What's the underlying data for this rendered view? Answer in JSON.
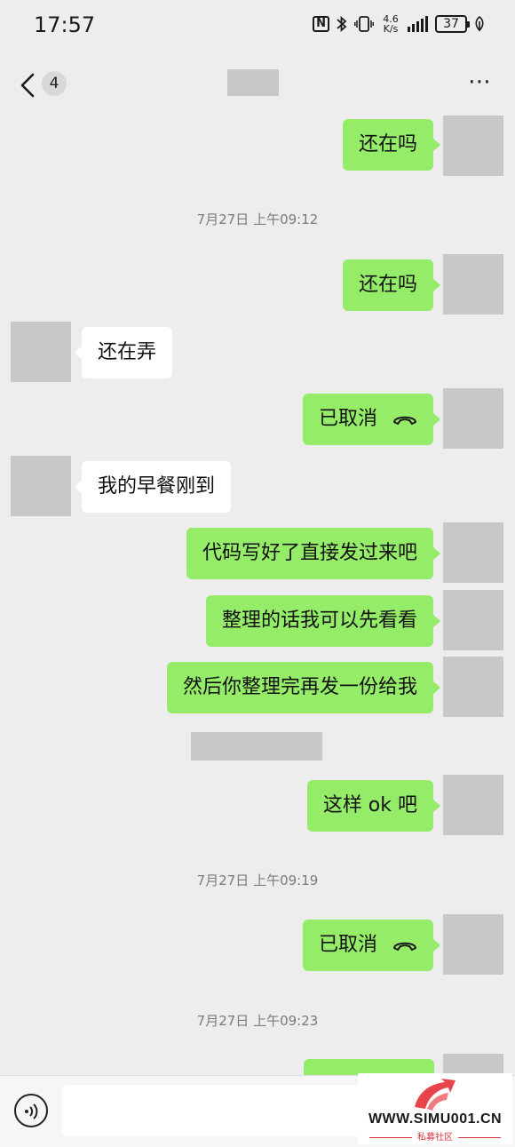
{
  "status_bar": {
    "time": "17:57",
    "nfc": "N",
    "net_speed_value": "4.6",
    "net_speed_unit": "K/s",
    "battery": "37"
  },
  "header": {
    "unread_count": "4",
    "more_icon": "⋯"
  },
  "messages": [
    {
      "side": "out",
      "text": "还在吗"
    },
    {
      "side": "out",
      "text": "还在吗"
    },
    {
      "side": "in",
      "text": "还在弄"
    },
    {
      "side": "out",
      "text": "已取消",
      "icon": "hangup-icon"
    },
    {
      "side": "in",
      "text": "我的早餐刚到"
    },
    {
      "side": "out",
      "text": "代码写好了直接发过来吧"
    },
    {
      "side": "out",
      "text": "整理的话我可以先看看"
    },
    {
      "side": "out",
      "text": "然后你整理完再发一份给我"
    },
    {
      "side": "out",
      "text": "这样 ok 吧"
    },
    {
      "side": "out",
      "text": "已取消",
      "icon": "hangup-icon"
    }
  ],
  "timestamps": [
    "7月27日 上午09:12",
    "7月27日 上午09:19",
    "7月27日 上午09:23"
  ],
  "watermark": {
    "site": "WWW.SIMU001.CN",
    "sub": "私募社区"
  },
  "colors": {
    "outgoing_bubble": "#95ec69",
    "incoming_bubble": "#ffffff",
    "background": "#ededed",
    "watermark_red": "#d6323a"
  }
}
